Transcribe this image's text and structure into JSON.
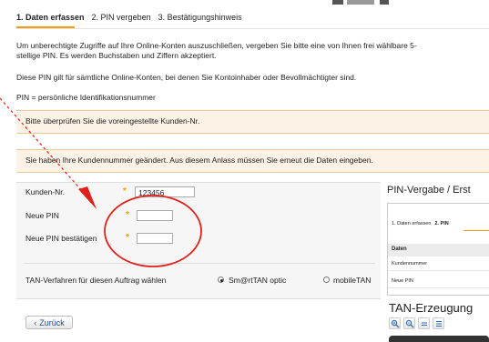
{
  "steps": [
    "1. Daten erfassen",
    "2. PIN vergeben",
    "3. Bestätigungshinweis"
  ],
  "intro": {
    "line1": "Um unberechtigte Zugriffe auf Ihre Online-Konten auszuschließen, vergeben Sie bitte eine von Ihnen frei wählbare 5-",
    "line2": "stellige PIN. Es werden Buchstaben und Ziffern akzeptiert.",
    "line3": "Diese PIN gilt für sämtliche Online-Konten, bei denen Sie Kontoinhaber oder Bevollmächtigter sind.",
    "line4": "PIN = persönliche Identifikationsnummer"
  },
  "notices": [
    "Bitte überprüfen Sie die voreingestellte Kunden-Nr.",
    "Sie haben Ihre Kundennummer geändert. Aus diesem Anlass müssen Sie erneut die Daten eingeben."
  ],
  "form": {
    "customer_label": "Kunden-Nr.",
    "customer_value": "123456",
    "pin_label": "Neue PIN",
    "pin_value": "",
    "pin_confirm_label": "Neue PIN bestätigen",
    "pin_confirm_value": "",
    "required_mark": "*",
    "tan_label": "TAN-Verfahren für diesen Auftrag wählen",
    "tan_options": [
      "Sm@rtTAN optic",
      "mobileTAN"
    ],
    "tan_selected": "Sm@rtTAN optic"
  },
  "back_button": {
    "label": "Zurück",
    "icon": "chevron-left-icon"
  },
  "popup": {
    "title": "PIN-Vergabe / Erst",
    "steps": [
      "1. Daten erfassen",
      "2. PIN"
    ],
    "table_header": "Daten",
    "rows": [
      "Kundennummer",
      "Neue PIN"
    ],
    "tan_title": "TAN-Erzeugung",
    "toolbar_icons": [
      "zoom-in-icon",
      "zoom-out-icon",
      "align-icon",
      "lines-icon"
    ]
  },
  "colors": {
    "accent": "#f39c12",
    "annotation": "#e0201b",
    "notice_bg": "#fdf2e6"
  }
}
